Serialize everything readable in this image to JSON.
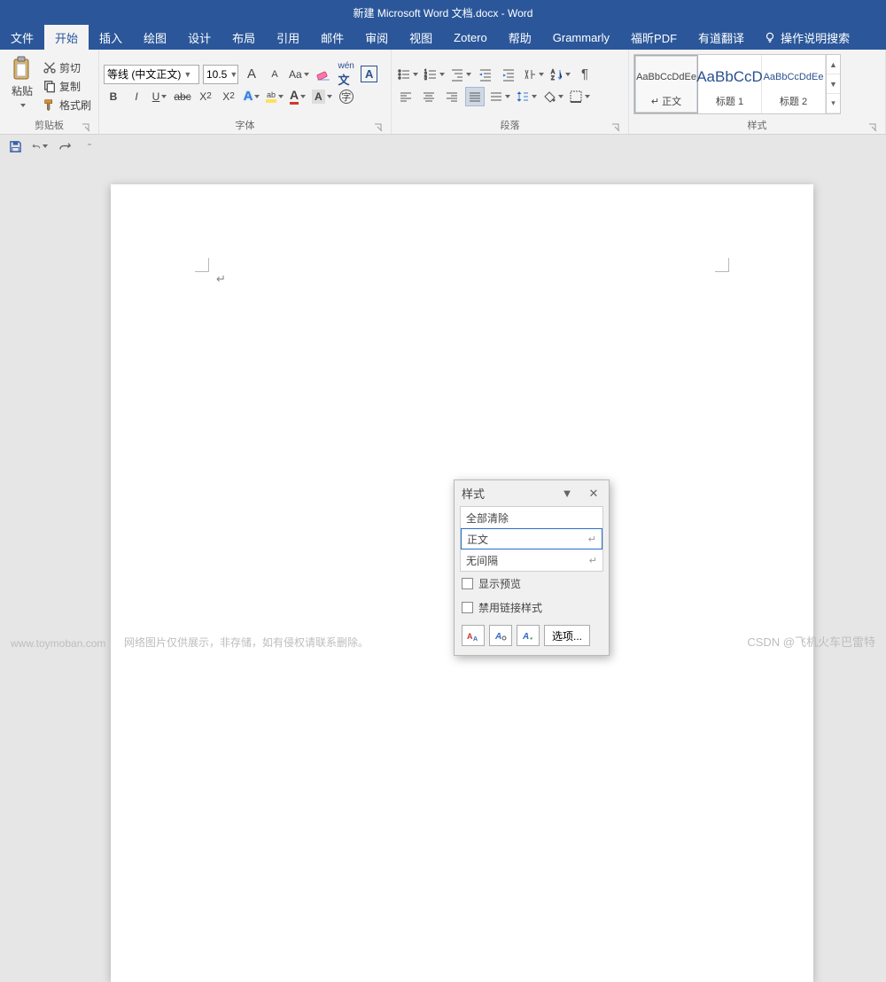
{
  "title": "新建 Microsoft Word 文档.docx  -  Word",
  "tabs": [
    "文件",
    "开始",
    "插入",
    "绘图",
    "设计",
    "布局",
    "引用",
    "邮件",
    "审阅",
    "视图",
    "Zotero",
    "帮助",
    "Grammarly",
    "福昕PDF",
    "有道翻译"
  ],
  "active_tab": "开始",
  "tellme": "操作说明搜索",
  "clipboard": {
    "label": "剪贴板",
    "paste": "粘贴",
    "cut": "剪切",
    "copy": "复制",
    "painter": "格式刷"
  },
  "font": {
    "label": "字体",
    "name": "等线 (中文正文)",
    "size": "10.5",
    "grow": "A",
    "shrink": "A",
    "case": "Aa",
    "b": "B",
    "i": "I",
    "u": "U",
    "abc": "abc",
    "x2": "X",
    "x2b": "2",
    "ax": "X",
    "axb": "2",
    "charA": "A"
  },
  "para": {
    "label": "段落"
  },
  "styles": {
    "label": "样式",
    "items": [
      {
        "preview": "AaBbCcDdEe",
        "name": "↵ 正文"
      },
      {
        "preview": "AaBbCcD",
        "name": "标题 1"
      },
      {
        "preview": "AaBbCcDdEe",
        "name": "标题 2"
      }
    ]
  },
  "pane": {
    "title": "样式",
    "clear": "全部清除",
    "normal": "正文",
    "nospace": "无间隔",
    "show_preview": "显示预览",
    "disable_link": "禁用链接样式",
    "options": "选项..."
  },
  "watermark": {
    "left": "www.toymoban.com",
    "center": "网络图片仅供展示，非存储，如有侵权请联系删除。",
    "right": "CSDN @飞机火车巴雷特"
  }
}
